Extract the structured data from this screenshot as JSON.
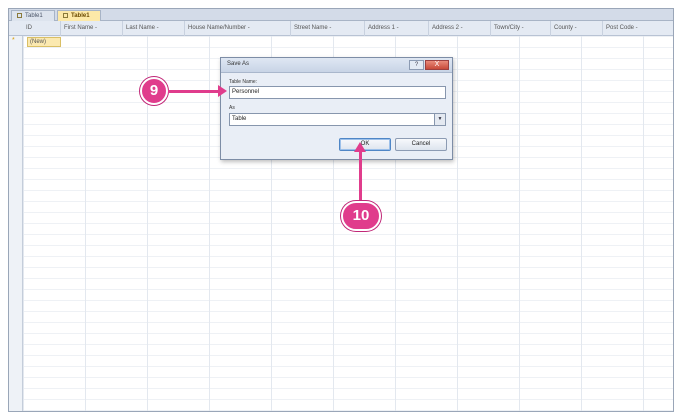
{
  "tabs": [
    {
      "label": "Table1"
    },
    {
      "label": "Table1"
    }
  ],
  "columns": [
    {
      "label": "ID"
    },
    {
      "label": "First Name  -"
    },
    {
      "label": "Last Name  -"
    },
    {
      "label": "House Name/Number  -"
    },
    {
      "label": "Street Name  -"
    },
    {
      "label": "Address 1  -"
    },
    {
      "label": "Address 2  -"
    },
    {
      "label": "Town/City  -"
    },
    {
      "label": "County  -"
    },
    {
      "label": "Post Code  -"
    }
  ],
  "new_row": {
    "marker": "*",
    "value": "(New)"
  },
  "dialog": {
    "title": "Save As",
    "help_label": "?",
    "close_label": "X",
    "name_label": "Table Name:",
    "name_value": "Personnel",
    "as_label": "As",
    "as_value": "Table",
    "ok_label": "OK",
    "cancel_label": "Cancel"
  },
  "callouts": {
    "step_a": "9",
    "step_b": "10"
  },
  "colors": {
    "callout": "#e03c8c",
    "active_tab": "#fde9a8"
  }
}
